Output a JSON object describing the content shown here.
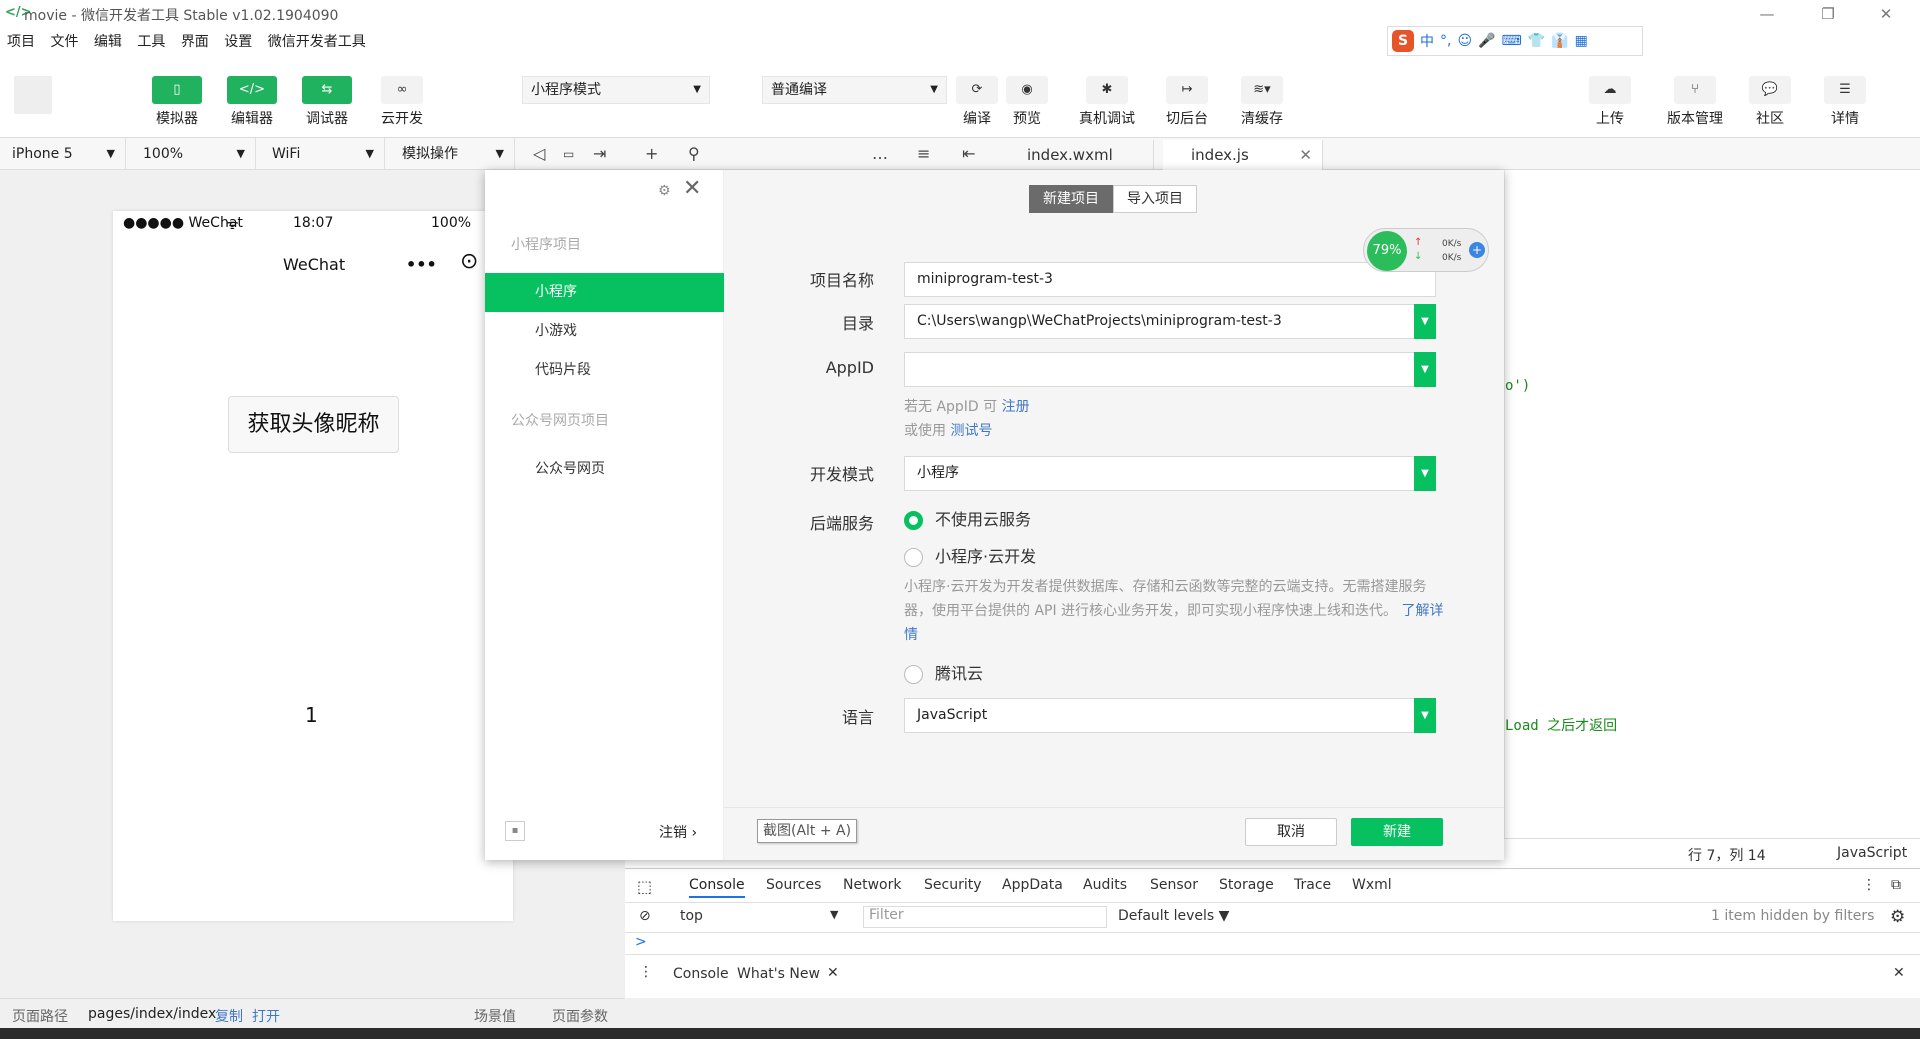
{
  "titlebar": {
    "title": "movie - 微信开发者工具 Stable v1.02.1904090",
    "logo": "</>",
    "min": "—",
    "restore": "❐",
    "close": "✕"
  },
  "menubar": {
    "items": [
      "项目",
      "文件",
      "编辑",
      "工具",
      "界面",
      "设置",
      "微信开发者工具"
    ]
  },
  "ime": {
    "logo": "S",
    "glyphs": [
      "中",
      "°,",
      "☺",
      "🎤",
      "⌨",
      "👕",
      "👔",
      "▦"
    ]
  },
  "toolbar": {
    "simulator": "模拟器",
    "editor": "编辑器",
    "debugger": "调试器",
    "cloud": "云开发",
    "mode_select": "小程序模式",
    "compile_select": "普通编译",
    "compile": "编译",
    "preview": "预览",
    "remote_debug": "真机调试",
    "background": "切后台",
    "clear_cache": "清缓存",
    "upload": "上传",
    "version": "版本管理",
    "community": "社区",
    "details": "详情"
  },
  "subbar": {
    "device": "iPhone 5",
    "zoom": "100%",
    "network": "WiFi",
    "simulate_op": "模拟操作",
    "tabs": [
      "index.wxml",
      "index.js"
    ]
  },
  "phone": {
    "signal": "●●●●● WeChat",
    "wifi": "ᯤ",
    "time": "18:07",
    "battery": "100%",
    "nav_title": "WeChat",
    "nav_dots": "•••",
    "nav_target": "⊙",
    "avatar_button": "获取头像昵称",
    "number": "1"
  },
  "editor": {
    "code_1": "o')",
    "code_2": "Load 之后才返回",
    "status_pos": "行 7，列 14",
    "status_lang": "JavaScript"
  },
  "devtools": {
    "tabs": [
      "Console",
      "Sources",
      "Network",
      "Security",
      "AppData",
      "Audits",
      "Sensor",
      "Storage",
      "Trace",
      "Wxml"
    ],
    "context": "top",
    "filter_placeholder": "Filter",
    "levels": "Default levels ▼",
    "hidden": "1 item hidden by filters",
    "prompt": ">",
    "drawer_tabs": [
      "Console",
      "What's New"
    ]
  },
  "bottombar": {
    "path_label": "页面路径",
    "path": "pages/index/index",
    "copy": "复制",
    "open": "打开",
    "scene": "场景值",
    "params": "页面参数"
  },
  "dialog": {
    "side": {
      "group1": "小程序项目",
      "items1": [
        "小程序",
        "小游戏",
        "代码片段"
      ],
      "group2": "公众号网页项目",
      "items2": [
        "公众号网页"
      ],
      "logout": "注销 ›"
    },
    "tabs": [
      "新建项目",
      "导入项目"
    ],
    "fields": {
      "name_label": "项目名称",
      "name_value": "miniprogram-test-3",
      "dir_label": "目录",
      "dir_value": "C:\\Users\\wangp\\WeChatProjects\\miniprogram-test-3",
      "appid_label": "AppID",
      "appid_value": "",
      "hint1_pre": "若无 AppID 可",
      "hint1_link": "注册",
      "hint2_pre": "或使用",
      "hint2_link": "测试号",
      "mode_label": "开发模式",
      "mode_value": "小程序",
      "backend_label": "后端服务",
      "opt1": "不使用云服务",
      "opt2": "小程序·云开发",
      "desc": "小程序·云开发为开发者提供数据库、存储和云函数等完整的云端支持。无需搭建服务器，使用平台提供的 API 进行核心业务开发，即可实现小程序快速上线和迭代。",
      "desc_link": "了解详情",
      "opt3": "腾讯云",
      "lang_label": "语言",
      "lang_value": "JavaScript"
    },
    "screenshot_btn": "截图(Alt + A)",
    "cancel": "取消",
    "create": "新建"
  },
  "netwidget": {
    "percent": "79%",
    "up": "0K/s",
    "down": "0K/s"
  }
}
